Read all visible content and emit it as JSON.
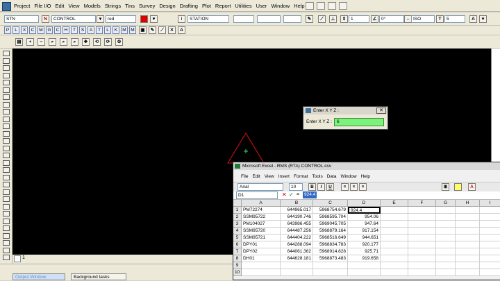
{
  "menubar": {
    "items": [
      "Project",
      "File I/O",
      "Edit",
      "View",
      "Models",
      "Strings",
      "Tins",
      "Survey",
      "Design",
      "Drafting",
      "Plot",
      "Report",
      "Utilities",
      "User",
      "Window",
      "Help"
    ]
  },
  "toolbar1": {
    "string_type": "STN",
    "name_button": "N",
    "model": "CONTROL",
    "colour": "red",
    "colour_swatch": "#e00000",
    "string_name": "STATION",
    "width_value": "1",
    "angle_value": "0°",
    "style": "ISO",
    "size_value": "5"
  },
  "letter_buttons": [
    "P",
    "L",
    "X",
    "C",
    "M",
    "G",
    "C",
    "H",
    "T",
    "S",
    "A",
    "T",
    "L",
    "K",
    "M",
    "M"
  ],
  "dialog": {
    "title": "Enter X Y Z :",
    "label": "Enter X Y Z :",
    "value": "6",
    "close_label": "✕"
  },
  "excel": {
    "title": "Microsoft Excel - RMS (RTA) CONTROL.csv",
    "menu": [
      "File",
      "Edit",
      "View",
      "Insert",
      "Format",
      "Tools",
      "Data",
      "Window",
      "Help"
    ],
    "font_name": "Arial",
    "font_size": "10",
    "bold": "B",
    "italic": "I",
    "underline": "U",
    "name_box": "D1",
    "formula_value": "924.4",
    "columns": [
      "A",
      "B",
      "C",
      "D",
      "E",
      "F",
      "G",
      "H",
      "I"
    ],
    "rows": [
      {
        "n": "1",
        "a": "PM72274",
        "b": "644965.017",
        "c": "5968754.679",
        "d": "924.4"
      },
      {
        "n": "2",
        "a": "SSM95722",
        "b": "644190.746",
        "c": "5968595.704",
        "d": "954.06"
      },
      {
        "n": "3",
        "a": "PM104027",
        "b": "643986.455",
        "c": "5969045.705",
        "d": "947.64"
      },
      {
        "n": "4",
        "a": "SSM95720",
        "b": "644487.256",
        "c": "5968879.164",
        "d": "917.154"
      },
      {
        "n": "5",
        "a": "SSM95721",
        "b": "644404.222",
        "c": "5968516.649",
        "d": "944.651"
      },
      {
        "n": "6",
        "a": "DPY01",
        "b": "644288.094",
        "c": "5968834.783",
        "d": "920.177"
      },
      {
        "n": "7",
        "a": "DPY02",
        "b": "644061.362",
        "c": "5968914.828",
        "d": "925.71"
      },
      {
        "n": "8",
        "a": "DH01",
        "b": "644628.181",
        "c": "5968873.483",
        "d": "919.658"
      },
      {
        "n": "9",
        "a": "",
        "b": "",
        "c": "",
        "d": ""
      },
      {
        "n": "10",
        "a": "",
        "b": "",
        "c": "",
        "d": ""
      }
    ]
  },
  "status": {
    "page_tab": "1"
  },
  "bottom_tabs": {
    "output": "Output Window",
    "background": "Background tasks"
  }
}
